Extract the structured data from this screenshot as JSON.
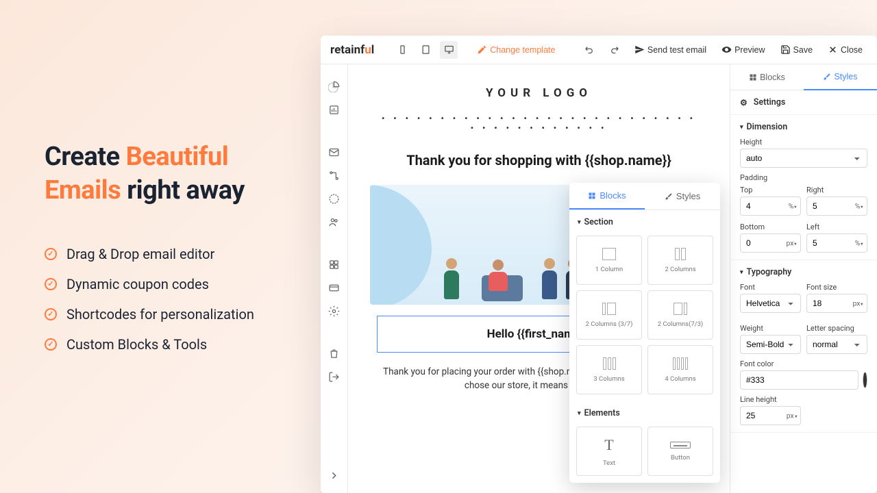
{
  "marketing": {
    "heading_pre": "Create ",
    "heading_accent": "Beautiful Emails",
    "heading_post": " right away",
    "features": [
      "Drag & Drop email editor",
      "Dynamic coupon codes",
      "Shortcodes for personalization",
      "Custom Blocks & Tools"
    ]
  },
  "app": {
    "logo_pre": "retainf",
    "logo_accent": "u",
    "logo_post": "l",
    "topbar": {
      "change_template": "Change template",
      "send_test": "Send test email",
      "preview": "Preview",
      "save": "Save",
      "close": "Close"
    },
    "email": {
      "logo_text": "YOUR LOGO",
      "heading": "Thank you for shopping with {{shop.name}}",
      "hello": "Hello {{first_name}},",
      "paragraph": "Thank you for placing your order with {{shop.name}}. We appreciate that you chose our store, it means a lot to us."
    },
    "popup": {
      "tab_blocks": "Blocks",
      "tab_styles": "Styles",
      "section_label": "Section",
      "elements_label": "Elements",
      "blocks": {
        "col1": "1 Column",
        "col2": "2 Columns",
        "col2_37": "2 Columns (3/7)",
        "col2_73": "2 Columns(7/3)",
        "col3": "3 Columns",
        "col4": "4 Columns",
        "text": "Text",
        "button": "Button"
      }
    },
    "rightpanel": {
      "tab_blocks": "Blocks",
      "tab_styles": "Styles",
      "settings": "Settings",
      "dimension": {
        "title": "Dimension",
        "height_label": "Height",
        "height_value": "auto",
        "padding_label": "Padding",
        "top_label": "Top",
        "top_value": "4",
        "top_unit": "%",
        "right_label": "Right",
        "right_value": "5",
        "right_unit": "%",
        "bottom_label": "Bottom",
        "bottom_value": "0",
        "bottom_unit": "px",
        "left_label": "Left",
        "left_value": "5",
        "left_unit": "%"
      },
      "typography": {
        "title": "Typography",
        "font_label": "Font",
        "font_value": "Helvetica",
        "fontsize_label": "Font size",
        "fontsize_value": "18",
        "fontsize_unit": "px",
        "weight_label": "Weight",
        "weight_value": "Semi-Bold",
        "spacing_label": "Letter spacing",
        "spacing_value": "normal",
        "color_label": "Font color",
        "color_value": "#333",
        "lineheight_label": "Line height",
        "lineheight_value": "25",
        "lineheight_unit": "px"
      }
    }
  }
}
